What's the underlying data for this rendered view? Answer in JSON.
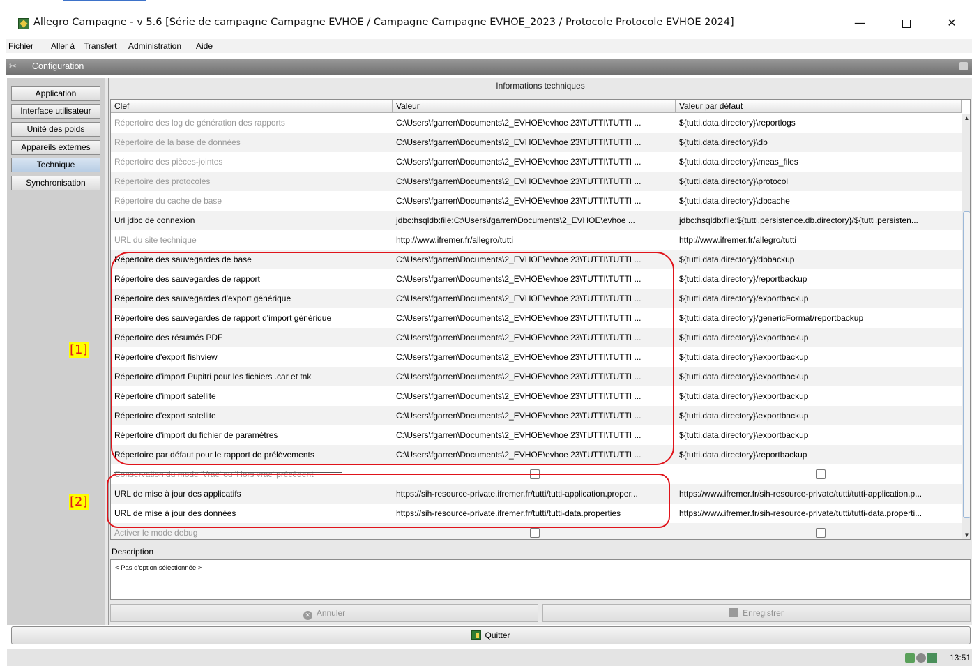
{
  "window": {
    "title": "Allegro Campagne - v 5.6 [Série de campagne Campagne EVHOE / Campagne Campagne EVHOE_2023 / Protocole Protocole EVHOE 2024]",
    "minimize": "—",
    "close": "✕"
  },
  "menubar": [
    "Fichier",
    "Aller à",
    "Transfert",
    "Administration",
    "Aide"
  ],
  "config_bar": {
    "title": "Configuration",
    "icon": "scissors-icon"
  },
  "sidebar": {
    "items": [
      {
        "label": "Application",
        "active": false
      },
      {
        "label": "Interface utilisateur",
        "active": false
      },
      {
        "label": "Unité des poids",
        "active": false
      },
      {
        "label": "Appareils externes",
        "active": false
      },
      {
        "label": "Technique",
        "active": true
      },
      {
        "label": "Synchronisation",
        "active": false
      }
    ]
  },
  "table": {
    "title": "Informations techniques",
    "columns": [
      "Clef",
      "Valeur",
      "Valeur par défaut"
    ],
    "rows": [
      {
        "key": "Répertoire des log de génération des rapports",
        "value": "C:\\Users\\fgarren\\Documents\\2_EVHOE\\evhoe 23\\TUTTI\\TUTTI ...",
        "default": "${tutti.data.directory}\\reportlogs",
        "disabled": true
      },
      {
        "key": "Répertoire de la base de données",
        "value": "C:\\Users\\fgarren\\Documents\\2_EVHOE\\evhoe 23\\TUTTI\\TUTTI ...",
        "default": "${tutti.data.directory}\\db",
        "disabled": true
      },
      {
        "key": "Répertoire des pièces-jointes",
        "value": "C:\\Users\\fgarren\\Documents\\2_EVHOE\\evhoe 23\\TUTTI\\TUTTI ...",
        "default": "${tutti.data.directory}\\meas_files",
        "disabled": true
      },
      {
        "key": "Répertoire des protocoles",
        "value": "C:\\Users\\fgarren\\Documents\\2_EVHOE\\evhoe 23\\TUTTI\\TUTTI ...",
        "default": "${tutti.data.directory}\\protocol",
        "disabled": true
      },
      {
        "key": "Répertoire du cache de base",
        "value": "C:\\Users\\fgarren\\Documents\\2_EVHOE\\evhoe 23\\TUTTI\\TUTTI ...",
        "default": "${tutti.data.directory}\\dbcache",
        "disabled": true
      },
      {
        "key": "Url jdbc de connexion",
        "value": "jdbc:hsqldb:file:C:\\Users\\fgarren\\Documents\\2_EVHOE\\evhoe ...",
        "default": "jdbc:hsqldb:file:${tutti.persistence.db.directory}/${tutti.persisten...",
        "disabled": false
      },
      {
        "key": "URL du site technique",
        "value": "http://www.ifremer.fr/allegro/tutti",
        "default": "http://www.ifremer.fr/allegro/tutti",
        "disabled": true
      },
      {
        "key": "Répertoire des sauvegardes de base",
        "value": "C:\\Users\\fgarren\\Documents\\2_EVHOE\\evhoe 23\\TUTTI\\TUTTI ...",
        "default": "${tutti.data.directory}/dbbackup",
        "disabled": false
      },
      {
        "key": "Répertoire des sauvegardes de rapport",
        "value": "C:\\Users\\fgarren\\Documents\\2_EVHOE\\evhoe 23\\TUTTI\\TUTTI ...",
        "default": "${tutti.data.directory}/reportbackup",
        "disabled": false
      },
      {
        "key": "Répertoire des sauvegardes d'export générique",
        "value": "C:\\Users\\fgarren\\Documents\\2_EVHOE\\evhoe 23\\TUTTI\\TUTTI ...",
        "default": "${tutti.data.directory}/exportbackup",
        "disabled": false
      },
      {
        "key": "Répertoire des sauvegardes de rapport d'import générique",
        "value": "C:\\Users\\fgarren\\Documents\\2_EVHOE\\evhoe 23\\TUTTI\\TUTTI ...",
        "default": "${tutti.data.directory}/genericFormat/reportbackup",
        "disabled": false
      },
      {
        "key": "Répertoire des résumés PDF",
        "value": "C:\\Users\\fgarren\\Documents\\2_EVHOE\\evhoe 23\\TUTTI\\TUTTI ...",
        "default": "${tutti.data.directory}\\exportbackup",
        "disabled": false
      },
      {
        "key": "Répertoire d'export fishview",
        "value": "C:\\Users\\fgarren\\Documents\\2_EVHOE\\evhoe 23\\TUTTI\\TUTTI ...",
        "default": "${tutti.data.directory}\\exportbackup",
        "disabled": false
      },
      {
        "key": "Répertoire d'import Pupitri pour les fichiers .car et tnk",
        "value": "C:\\Users\\fgarren\\Documents\\2_EVHOE\\evhoe 23\\TUTTI\\TUTTI ...",
        "default": "${tutti.data.directory}\\exportbackup",
        "disabled": false
      },
      {
        "key": "Répertoire d'import satellite",
        "value": "C:\\Users\\fgarren\\Documents\\2_EVHOE\\evhoe 23\\TUTTI\\TUTTI ...",
        "default": "${tutti.data.directory}\\exportbackup",
        "disabled": false
      },
      {
        "key": "Répertoire d'export satellite",
        "value": "C:\\Users\\fgarren\\Documents\\2_EVHOE\\evhoe 23\\TUTTI\\TUTTI ...",
        "default": "${tutti.data.directory}\\exportbackup",
        "disabled": false
      },
      {
        "key": "Répertoire d'import du fichier de paramètres",
        "value": "C:\\Users\\fgarren\\Documents\\2_EVHOE\\evhoe 23\\TUTTI\\TUTTI ...",
        "default": "${tutti.data.directory}\\exportbackup",
        "disabled": false
      },
      {
        "key": "Répertoire par défaut pour le rapport de prélèvements",
        "value": "C:\\Users\\fgarren\\Documents\\2_EVHOE\\evhoe 23\\TUTTI\\TUTTI ...",
        "default": "${tutti.data.directory}\\reportbackup",
        "disabled": false
      },
      {
        "key": "Conservation du mode 'Vrac' ou 'Hors vrac' précédent",
        "value": "",
        "default": "",
        "disabled": true,
        "checkbox": true
      },
      {
        "key": "URL de mise à jour des applicatifs",
        "value": "https://sih-resource-private.ifremer.fr/tutti/tutti-application.proper...",
        "default": "https://www.ifremer.fr/sih-resource-private/tutti/tutti-application.p...",
        "disabled": false
      },
      {
        "key": "URL de mise à jour des données",
        "value": "https://sih-resource-private.ifremer.fr/tutti/tutti-data.properties",
        "default": "https://www.ifremer.fr/sih-resource-private/tutti/tutti-data.properti...",
        "disabled": false
      },
      {
        "key": "Activer le mode debug",
        "value": "",
        "default": "",
        "disabled": true,
        "checkbox": true
      }
    ]
  },
  "description": {
    "label": "Description",
    "text": "< Pas d'option sélectionnée >"
  },
  "buttons": {
    "cancel": "Annuler",
    "save": "Enregistrer",
    "quit": "Quitter"
  },
  "statusbar": {
    "clock": "13:51"
  },
  "annotations": {
    "box1": "[1]",
    "box2": "[2]",
    "color": "#e0141b",
    "highlight": "#ffff00"
  }
}
